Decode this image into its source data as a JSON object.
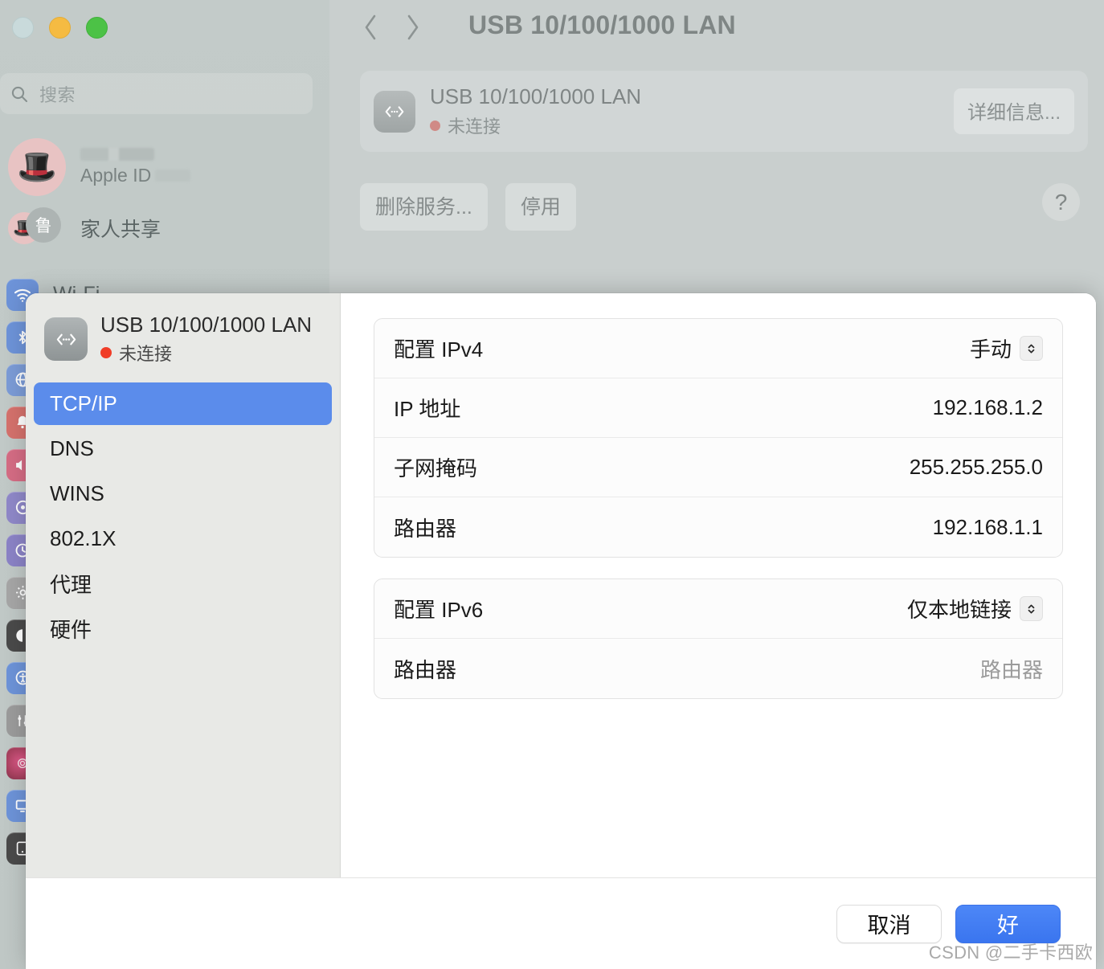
{
  "window": {
    "traffic_lights": [
      "close",
      "minimize",
      "maximize"
    ]
  },
  "sidebar": {
    "search": {
      "placeholder": "搜索",
      "value": "",
      "icon": "search-icon"
    },
    "profile": {
      "apple_id_label": "Apple ID",
      "name_redacted": true
    },
    "family": {
      "label": "家人共享",
      "badge": "鲁"
    },
    "items": [
      {
        "label": "Wi-Fi",
        "icon": "wifi-icon",
        "color": "#6d93d8"
      },
      {
        "label": "",
        "icon": "bluetooth-icon",
        "color": "#6d93d8"
      },
      {
        "label": "",
        "icon": "network-globe-icon",
        "color": "#7b9bd6"
      },
      {
        "label": "",
        "icon": "notifications-icon",
        "color": "#d4716c"
      },
      {
        "label": "",
        "icon": "sound-icon",
        "color": "#d46c84"
      },
      {
        "label": "",
        "icon": "focus-icon",
        "color": "#8f88c8"
      },
      {
        "label": "",
        "icon": "screen-time-icon",
        "color": "#8b83c6"
      },
      {
        "label": "",
        "icon": "general-gear-icon",
        "color": "#a6a6a6"
      },
      {
        "label": "",
        "icon": "appearance-icon",
        "color": "#4a4a4a"
      },
      {
        "label": "",
        "icon": "accessibility-icon",
        "color": "#6d93d8"
      },
      {
        "label": "",
        "icon": "control-center-icon",
        "color": "#9b9b9b"
      },
      {
        "label": "",
        "icon": "siri-icon",
        "color": "#a8415f"
      },
      {
        "label": "",
        "icon": "desktop-dock-icon",
        "color": "#6d93d8"
      },
      {
        "label": "",
        "icon": "displays-icon",
        "color": "#4a4a4a"
      }
    ]
  },
  "header": {
    "back_icon": "chevron-left-icon",
    "forward_icon": "chevron-right-icon",
    "title": "USB 10/100/1000 LAN"
  },
  "interface_card": {
    "icon": "network-adapter-icon",
    "name": "USB 10/100/1000 LAN",
    "status": "未连接",
    "status_color": "#f03d27",
    "detail_button": "详细信息..."
  },
  "actions": {
    "remove_service": "删除服务...",
    "disable": "停用",
    "help": "?"
  },
  "sheet": {
    "head": {
      "icon": "network-adapter-icon",
      "name": "USB 10/100/1000 LAN",
      "status": "未连接",
      "status_color": "#f03d27"
    },
    "tabs": [
      {
        "label": "TCP/IP",
        "selected": true
      },
      {
        "label": "DNS",
        "selected": false
      },
      {
        "label": "WINS",
        "selected": false
      },
      {
        "label": "802.1X",
        "selected": false
      },
      {
        "label": "代理",
        "selected": false
      },
      {
        "label": "硬件",
        "selected": false
      }
    ],
    "selected_tab_color": "#5b8ceb",
    "ipv4": {
      "rows": [
        {
          "label": "配置 IPv4",
          "value": "手动",
          "stepper": true,
          "placeholder": false
        },
        {
          "label": "IP 地址",
          "value": "192.168.1.2",
          "stepper": false,
          "placeholder": false
        },
        {
          "label": "子网掩码",
          "value": "255.255.255.0",
          "stepper": false,
          "placeholder": false
        },
        {
          "label": "路由器",
          "value": "192.168.1.1",
          "stepper": false,
          "placeholder": false
        }
      ]
    },
    "ipv6": {
      "rows": [
        {
          "label": "配置 IPv6",
          "value": "仅本地链接",
          "stepper": true,
          "placeholder": false
        },
        {
          "label": "路由器",
          "value": "路由器",
          "stepper": false,
          "placeholder": true
        }
      ]
    },
    "footer": {
      "cancel": "取消",
      "ok": "好",
      "ok_color": "#3a75ef"
    }
  },
  "watermark": "CSDN @二手卡西欧"
}
